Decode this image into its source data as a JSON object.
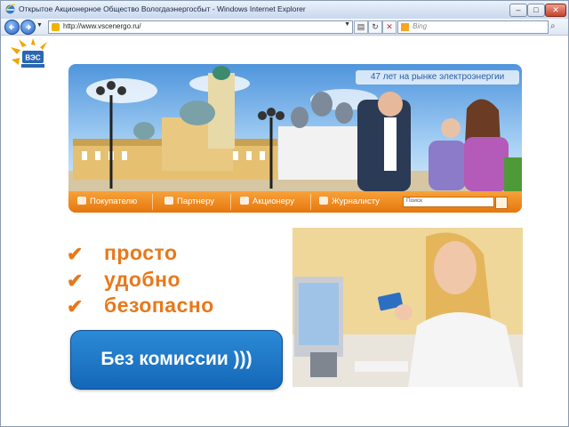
{
  "window": {
    "title": "Открытое Акционерное Общество Вологдаэнергосбыт - Windows Internet Explorer",
    "buttons": {
      "minimize": "–",
      "maximize": "□",
      "close": "✕"
    }
  },
  "toolbar": {
    "url": "http://www.vscenergo.ru/",
    "search_placeholder": "Bing",
    "icons": [
      "back-icon",
      "forward-icon",
      "dropdown-icon",
      "compatibility-icon",
      "refresh-icon",
      "stop-icon",
      "bing-icon",
      "search-icon"
    ]
  },
  "site": {
    "years_badge": "47 лет на рынке электроэнергии",
    "nav": [
      "Покупателю",
      "Партнеру",
      "Акционеру",
      "Журналисту"
    ],
    "search_placeholder": "Поиск"
  },
  "slide": {
    "bullets": [
      "просто",
      "удобно",
      "безопасно"
    ],
    "check_glyph": "✔",
    "cta": "Без комиссии )))"
  },
  "colors": {
    "accent": "#e8781a",
    "cta": "#1f78c8",
    "nav": "#ef8a20"
  }
}
